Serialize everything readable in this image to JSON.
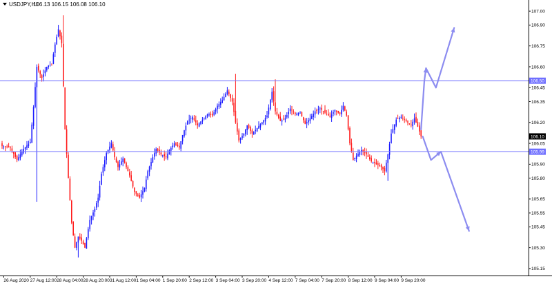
{
  "header": {
    "symbol": "USDJPY,H1",
    "ohlc": "106.13 106.15 106.08 106.10"
  },
  "colors": {
    "background": "#ffffff",
    "bull": "#1a1aff",
    "bear": "#ff1a1a",
    "level_line": "#7b7bff",
    "forecast_arrow": "#8c8cf0",
    "current_price_bg": "#000000",
    "level_badge_bg": "#6f6fff",
    "axis": "#000000"
  },
  "chart_data": {
    "type": "candlestick",
    "ylim": [
      105.1,
      107.08
    ],
    "yticks": [
      "107.00",
      "106.90",
      "106.75",
      "106.60",
      "106.45",
      "106.35",
      "106.20",
      "106.05",
      "105.90",
      "105.80",
      "105.65",
      "105.55",
      "105.45",
      "105.30",
      "105.15"
    ],
    "yticks_values": [
      107.0,
      106.9,
      106.75,
      106.6,
      106.45,
      106.35,
      106.2,
      106.05,
      105.9,
      105.8,
      105.65,
      105.55,
      105.45,
      105.3,
      105.15
    ],
    "xticks": [
      "26 Aug 2020",
      "27 Aug 12:00",
      "28 Aug 04:00",
      "28 Aug 20:00",
      "31 Aug 12:00",
      "1 Sep 04:00",
      "1 Sep 20:00",
      "2 Sep 12:00",
      "3 Sep 04:00",
      "3 Sep 20:00",
      "4 Sep 12:00",
      "7 Sep 04:00",
      "7 Sep 20:00",
      "8 Sep 12:00",
      "9 Sep 04:00",
      "9 Sep 20:00"
    ],
    "xtick_bars": [
      1,
      17,
      33,
      49,
      65,
      81,
      97,
      113,
      129,
      145,
      161,
      177,
      193,
      209,
      225,
      241
    ],
    "levels": [
      {
        "label": "106.50",
        "value": 106.5
      },
      {
        "label": "105.99",
        "value": 105.99
      }
    ],
    "current_price": {
      "label": "106.10",
      "value": 106.1
    },
    "path": [
      [
        0,
        106.03
      ],
      [
        5,
        106.02
      ],
      [
        9,
        105.93
      ],
      [
        13,
        106.01
      ],
      [
        17,
        106.06
      ],
      [
        19,
        106.31
      ],
      [
        21,
        106.6
      ],
      [
        24,
        106.52
      ],
      [
        27,
        106.6
      ],
      [
        30,
        106.62
      ],
      [
        32,
        106.76
      ],
      [
        34,
        106.87
      ],
      [
        36,
        106.77
      ],
      [
        38,
        106.15
      ],
      [
        40,
        105.8
      ],
      [
        42,
        105.48
      ],
      [
        44,
        105.3
      ],
      [
        46,
        105.38
      ],
      [
        48,
        105.35
      ],
      [
        50,
        105.3
      ],
      [
        53,
        105.5
      ],
      [
        56,
        105.58
      ],
      [
        58,
        105.66
      ],
      [
        60,
        105.83
      ],
      [
        63,
        105.98
      ],
      [
        66,
        106.05
      ],
      [
        68,
        105.95
      ],
      [
        70,
        105.88
      ],
      [
        73,
        105.94
      ],
      [
        77,
        105.82
      ],
      [
        80,
        105.7
      ],
      [
        83,
        105.66
      ],
      [
        86,
        105.73
      ],
      [
        88,
        105.85
      ],
      [
        91,
        105.95
      ],
      [
        93,
        106.01
      ],
      [
        96,
        105.97
      ],
      [
        99,
        105.95
      ],
      [
        101,
        106.0
      ],
      [
        104,
        106.05
      ],
      [
        107,
        106.02
      ],
      [
        109,
        106.11
      ],
      [
        112,
        106.21
      ],
      [
        115,
        106.24
      ],
      [
        118,
        106.18
      ],
      [
        121,
        106.22
      ],
      [
        124,
        106.26
      ],
      [
        127,
        106.25
      ],
      [
        130,
        106.32
      ],
      [
        133,
        106.36
      ],
      [
        136,
        106.43
      ],
      [
        139,
        106.35
      ],
      [
        141,
        106.2
      ],
      [
        143,
        106.07
      ],
      [
        146,
        106.12
      ],
      [
        148,
        106.18
      ],
      [
        151,
        106.12
      ],
      [
        154,
        106.16
      ],
      [
        157,
        106.2
      ],
      [
        160,
        106.25
      ],
      [
        163,
        106.42
      ],
      [
        165,
        106.28
      ],
      [
        168,
        106.21
      ],
      [
        171,
        106.23
      ],
      [
        174,
        106.3
      ],
      [
        177,
        106.26
      ],
      [
        180,
        106.27
      ],
      [
        183,
        106.19
      ],
      [
        186,
        106.23
      ],
      [
        189,
        106.28
      ],
      [
        192,
        106.3
      ],
      [
        195,
        106.27
      ],
      [
        198,
        106.24
      ],
      [
        201,
        106.29
      ],
      [
        204,
        106.26
      ],
      [
        206,
        106.32
      ],
      [
        208,
        106.25
      ],
      [
        210,
        106.05
      ],
      [
        212,
        105.93
      ],
      [
        214,
        105.96
      ],
      [
        217,
        106.0
      ],
      [
        220,
        105.97
      ],
      [
        223,
        105.92
      ],
      [
        226,
        105.9
      ],
      [
        229,
        105.88
      ],
      [
        231,
        105.85
      ],
      [
        233,
        105.97
      ],
      [
        235,
        106.12
      ],
      [
        238,
        106.22
      ],
      [
        241,
        106.24
      ],
      [
        244,
        106.21
      ],
      [
        247,
        106.18
      ],
      [
        249,
        106.23
      ],
      [
        251,
        106.17
      ],
      [
        253,
        106.1
      ]
    ],
    "extremes": [
      {
        "bar": 37,
        "value": 106.97
      },
      {
        "bar": 21,
        "value": 105.63
      },
      {
        "bar": 46,
        "value": 105.23
      },
      {
        "bar": 141,
        "value": 106.55
      },
      {
        "bar": 165,
        "value": 106.51
      },
      {
        "bar": 233,
        "value": 105.78
      }
    ],
    "forecast_paths": [
      [
        [
          253,
          106.15
        ],
        [
          255,
          106.5
        ],
        [
          256,
          106.59
        ]
      ],
      [
        [
          256,
          106.59
        ],
        [
          262,
          106.45
        ],
        [
          273,
          106.88
        ]
      ],
      [
        [
          254,
          106.1
        ],
        [
          259,
          105.93
        ],
        [
          265,
          105.99
        ]
      ],
      [
        [
          265,
          105.99
        ],
        [
          282,
          105.42
        ]
      ]
    ]
  }
}
